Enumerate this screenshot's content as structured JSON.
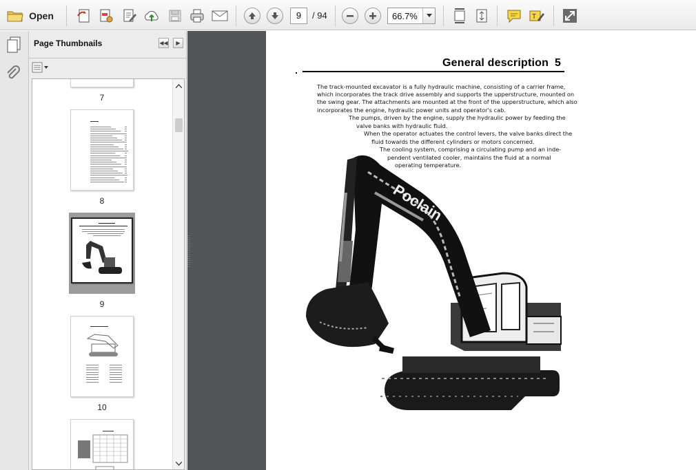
{
  "toolbar": {
    "open_label": "Open",
    "current_page": "9",
    "total_pages": "/ 94",
    "zoom": "66.7%"
  },
  "panel": {
    "title": "Page Thumbnails",
    "thumbnails": [
      {
        "label": "7"
      },
      {
        "label": "8"
      },
      {
        "label": "9"
      },
      {
        "label": "10"
      }
    ]
  },
  "page": {
    "heading": "General description",
    "number": "5",
    "lines": [
      "The track-mounted excavator is a fully hydraulic machine, consisting of a carrier frame,",
      "which incorporates the track drive assembly and supports the upperstructure, mounted on",
      "the swing gear. The attachments are mounted at the front of the upperstructure, which also",
      "incorporates the engine, hydraulic power units and operator's cab.",
      "The pumps, driven by the engine, supply the hydraulic power by feeding the",
      "valve banks with hydraulic fluid.",
      "When the operator actuates the control levers, the valve banks direct the",
      "fluid towards the different cylinders or motors concerned.",
      "The cooling system, comprising a circulating pump and an inde-",
      "pendent ventilated cooler, maintains the fluid at a normal",
      "operating temperature."
    ],
    "logo_text": "Poclain"
  },
  "colors": {
    "doc_background": "#525659",
    "panel_background": "#ececec",
    "toolbar_gradient_top": "#fbfbfb"
  }
}
